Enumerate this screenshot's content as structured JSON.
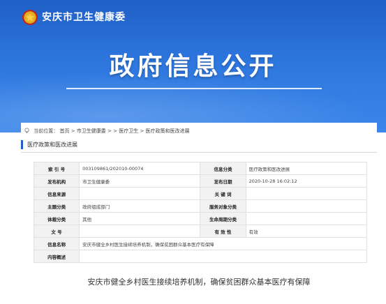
{
  "header": {
    "site_name": "安庆市卫生健康委"
  },
  "hero": {
    "title": "政府信息公开"
  },
  "breadcrumb": {
    "prefix": "当前位置：",
    "home": "首页",
    "sep1": " > ",
    "level1": "市卫生健康委",
    "sep2": " > > ",
    "level2": "医疗卫生",
    "sep3": " > ",
    "level3": "医疗政策和医改进展"
  },
  "section": {
    "title": "医疗政策和医改进展"
  },
  "meta": {
    "rows": [
      [
        {
          "k": "索 引 号",
          "v": "003109861/202010-00074"
        },
        {
          "k": "信息分类",
          "v": "医疗政策和医改进展"
        }
      ],
      [
        {
          "k": "发布机构",
          "v": "市卫生健康委"
        },
        {
          "k": "发布日期",
          "v": "2020-10-28 16:02:12"
        }
      ],
      [
        {
          "k": "信息来源",
          "v": ""
        },
        {
          "k": "关 键 词",
          "v": ""
        }
      ],
      [
        {
          "k": "主题分类",
          "v": "政府组成部门"
        },
        {
          "k": "服务对象分类",
          "v": ""
        }
      ],
      [
        {
          "k": "体裁分类",
          "v": "其他"
        },
        {
          "k": "生命周期分类",
          "v": ""
        }
      ],
      [
        {
          "k": "文 号",
          "v": ""
        },
        {
          "k": "有 效 性",
          "v": "有效"
        }
      ]
    ],
    "name_label": "信息名称",
    "name_value": "安庆市健全乡村医生接续培养机制，确保贫困群众基本医疗有保障",
    "summary_label": "内容概述",
    "summary_value": ""
  },
  "article": {
    "headline": "安庆市健全乡村医生接续培养机制，确保贫困群众基本医疗有保障"
  }
}
